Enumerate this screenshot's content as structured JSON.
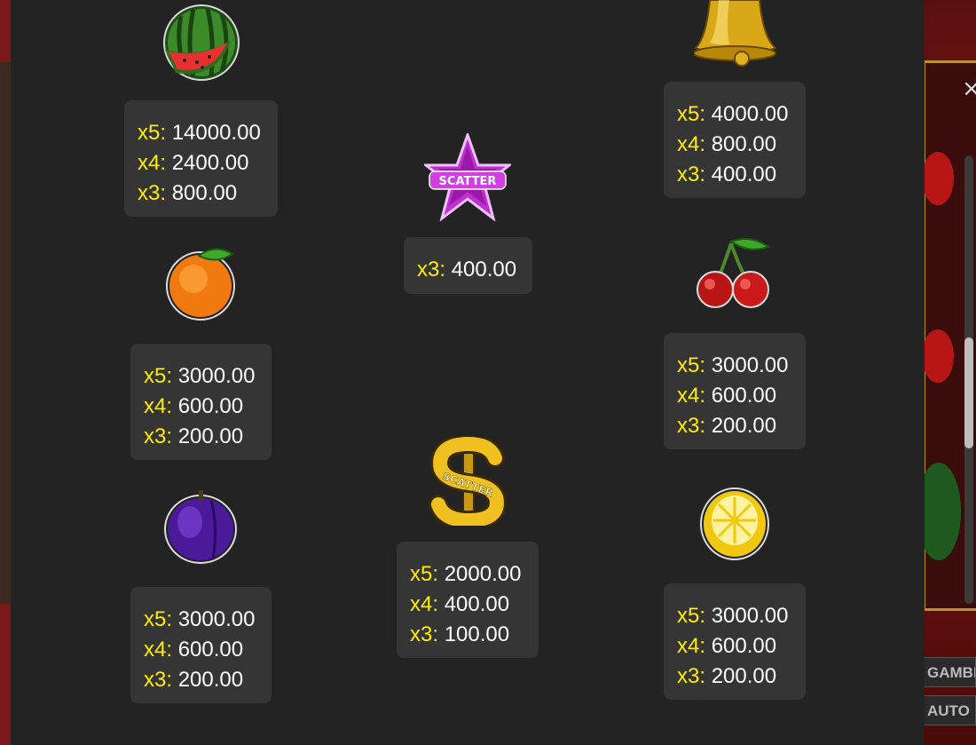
{
  "close_label": "×",
  "side_buttons": {
    "gamble": "GAMBLE",
    "auto": "AUTO"
  },
  "colors": {
    "panel": "#232323",
    "box": "#353535",
    "multiplier": "#ffee00",
    "value": "#ffffff"
  },
  "symbols": [
    {
      "name": "watermelon",
      "icon": "watermelon-icon",
      "pays": [
        {
          "mult": "x5:",
          "value": "14000.00"
        },
        {
          "mult": "x4:",
          "value": "2400.00"
        },
        {
          "mult": "x3:",
          "value": "800.00"
        }
      ]
    },
    {
      "name": "orange",
      "icon": "orange-icon",
      "pays": [
        {
          "mult": "x5:",
          "value": "3000.00"
        },
        {
          "mult": "x4:",
          "value": "600.00"
        },
        {
          "mult": "x3:",
          "value": "200.00"
        }
      ]
    },
    {
      "name": "plum",
      "icon": "plum-icon",
      "pays": [
        {
          "mult": "x5:",
          "value": "3000.00"
        },
        {
          "mult": "x4:",
          "value": "600.00"
        },
        {
          "mult": "x3:",
          "value": "200.00"
        }
      ]
    },
    {
      "name": "star-scatter",
      "icon": "star-scatter-icon",
      "label": "SCATTER",
      "pays": [
        {
          "mult": "x3:",
          "value": "400.00"
        }
      ]
    },
    {
      "name": "dollar-scatter",
      "icon": "dollar-scatter-icon",
      "label": "SCATTER",
      "pays": [
        {
          "mult": "x5:",
          "value": "2000.00"
        },
        {
          "mult": "x4:",
          "value": "400.00"
        },
        {
          "mult": "x3:",
          "value": "100.00"
        }
      ]
    },
    {
      "name": "bell",
      "icon": "bell-icon",
      "pays": [
        {
          "mult": "x5:",
          "value": "4000.00"
        },
        {
          "mult": "x4:",
          "value": "800.00"
        },
        {
          "mult": "x3:",
          "value": "400.00"
        }
      ]
    },
    {
      "name": "cherry",
      "icon": "cherry-icon",
      "pays": [
        {
          "mult": "x5:",
          "value": "3000.00"
        },
        {
          "mult": "x4:",
          "value": "600.00"
        },
        {
          "mult": "x3:",
          "value": "200.00"
        }
      ]
    },
    {
      "name": "lemon",
      "icon": "lemon-icon",
      "pays": [
        {
          "mult": "x5:",
          "value": "3000.00"
        },
        {
          "mult": "x4:",
          "value": "600.00"
        },
        {
          "mult": "x3:",
          "value": "200.00"
        }
      ]
    }
  ]
}
